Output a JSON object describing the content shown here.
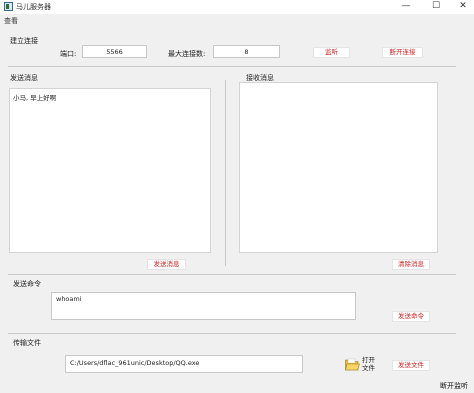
{
  "window": {
    "title": "马儿服务器",
    "minimize_glyph": "—",
    "maximize_glyph": "☐",
    "close_glyph": "✕"
  },
  "menu": {
    "items": [
      "查看"
    ]
  },
  "connection": {
    "section_label": "建立连接",
    "port_label": "端口:",
    "port_value": "5566",
    "max_conn_label": "最大连接数:",
    "max_conn_value": "8",
    "listen_button": "监听",
    "disconnect_button": "断开连接"
  },
  "send_message": {
    "section_label": "发送消息",
    "content": "小马, 早上好啊",
    "send_button": "发送消息"
  },
  "receive_message": {
    "section_label": "接收消息",
    "content": "",
    "clear_button": "清除消息"
  },
  "command": {
    "section_label": "发送命令",
    "value": "whoami",
    "send_button": "发送命令"
  },
  "file_transfer": {
    "section_label": "传输文件",
    "path_value": "C:/Users/dflac_961unic/Desktop/QQ.exe",
    "open_file_label": "打开文件",
    "send_button": "发送文件"
  },
  "status_bar": {
    "text": "断开监听"
  },
  "colors": {
    "accent_red": "#d21f1f",
    "background": "#f0f0f0"
  },
  "icons": {
    "app": "app-icon",
    "folder": "folder-open-icon"
  }
}
